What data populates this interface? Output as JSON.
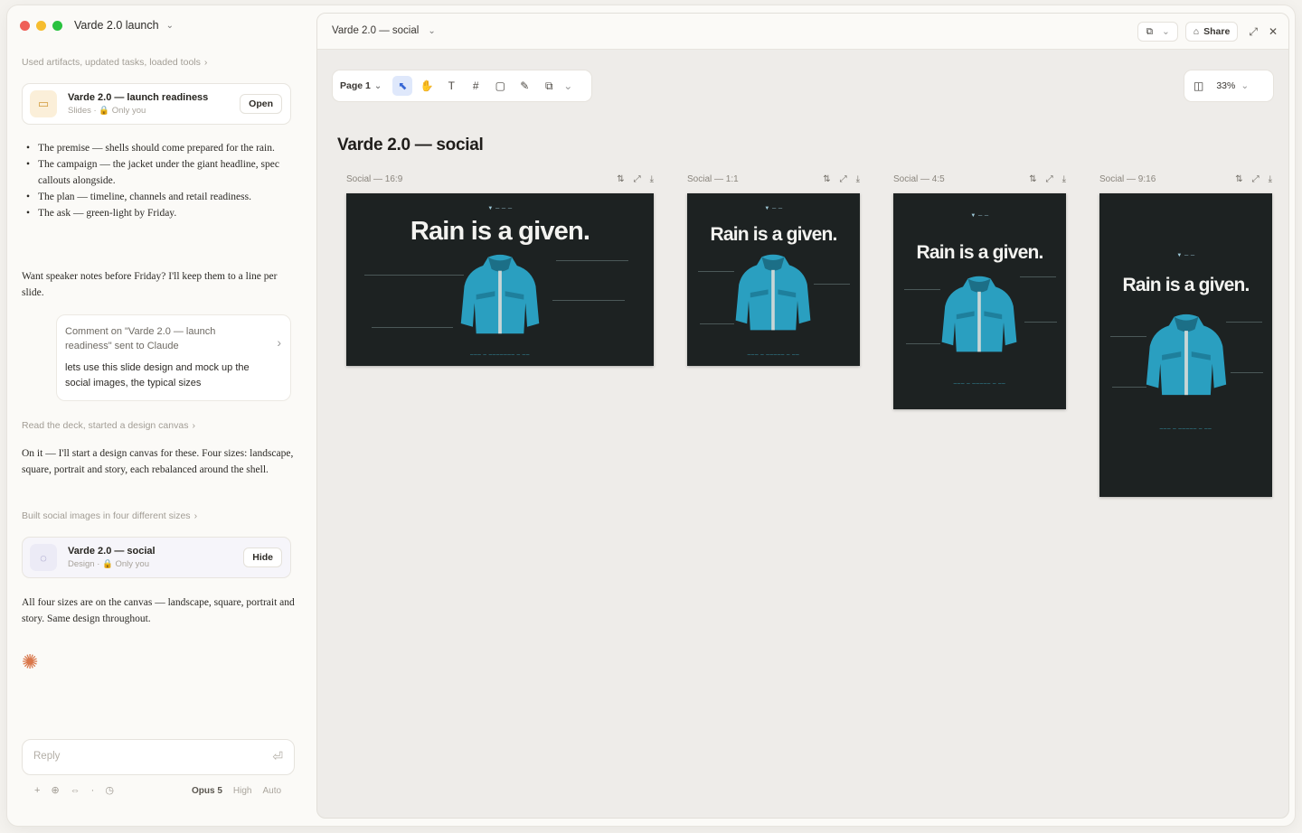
{
  "window": {
    "project_title": "Varde 2.0 launch"
  },
  "chat": {
    "trace_1": "Used artifacts, updated tasks, loaded tools",
    "artifact_1": {
      "title": "Varde 2.0 — launch readiness",
      "meta": "Slides · 🔒 Only you",
      "button": "Open"
    },
    "bullets": [
      "The premise — shells should come prepared for the rain.",
      "The campaign — the jacket under the giant headline, spec callouts alongside.",
      "The plan — timeline, channels and retail readiness.",
      "The ask — green-light by Friday."
    ],
    "para_1": "Want speaker notes before Friday? I'll keep them to a line per slide.",
    "comment": {
      "head": "Comment on \"Varde 2.0 — launch readiness\" sent to Claude",
      "body": "lets use this slide design and mock up the social images, the typical sizes"
    },
    "trace_2": "Read the deck, started a design canvas",
    "para_2": "On it — I'll start a design canvas for these. Four sizes: landscape, square, portrait and story, each rebalanced around the shell.",
    "trace_3": "Built social images in four different sizes",
    "artifact_2": {
      "title": "Varde 2.0 — social",
      "meta": "Design · 🔒 Only you",
      "button": "Hide"
    },
    "para_3": "All four sizes are on the canvas — landscape, square, portrait and story. Same design throughout.",
    "composer": {
      "placeholder": "Reply",
      "model": "Opus 5",
      "effort": "High",
      "mode": "Auto"
    }
  },
  "canvas": {
    "panel_title": "Varde 2.0 — social",
    "share_label": "Share",
    "page_label": "Page 1",
    "zoom": "33%",
    "title": "Varde 2.0 — social",
    "frames": [
      {
        "label": "Social — 16:9",
        "headline": "Rain is a given."
      },
      {
        "label": "Social — 1:1",
        "headline": "Rain is a given."
      },
      {
        "label": "Social — 4:5",
        "headline": "Rain is a given."
      },
      {
        "label": "Social — 9:16",
        "headline": "Rain is a given."
      }
    ]
  },
  "colors": {
    "accent": "#3868d6",
    "frame_bg": "#1d2222",
    "jacket": "#2a9fc0",
    "claude": "#d9774b"
  }
}
